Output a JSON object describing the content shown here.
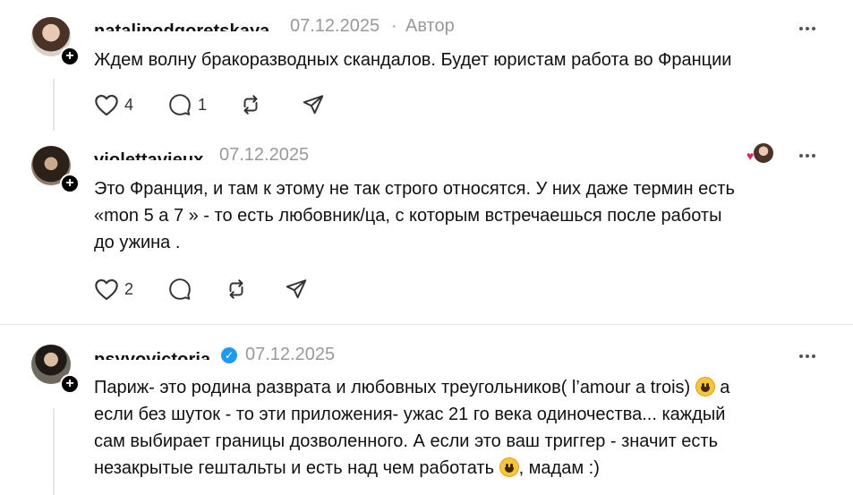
{
  "comments": [
    {
      "username": "natalipodgoretskaya",
      "date": "07.12.2025",
      "separator": "·",
      "author_tag": "Автор",
      "text": "Ждем волну бракоразводных скандалов. Будет юристам работа во Франции",
      "likes": "4",
      "replies": "1"
    },
    {
      "username": "violettavieux",
      "date": "07.12.2025",
      "text_lines": [
        "Это Франция, и там к этому не так строго относятся. У них даже термин есть",
        "«mon 5 a 7 » - то есть любовник/ца, с которым встречаешься после работы",
        "до ужина ."
      ],
      "likes": "2",
      "replies": ""
    },
    {
      "username": "psyvovictoria",
      "date": "07.12.2025",
      "verified": true,
      "text_parts": {
        "l1a": "Париж- это родина разврата и любовных треугольников( l’amour a trois) ",
        "l1b": " а",
        "l2": "если без шуток - то эти приложения- ужас 21 го века одиночества... каждый",
        "l3": "сам выбирает границы дозволенного. А если это ваш триггер - значит есть",
        "l4a": "незакрытые гештальты и есть над чем работать ",
        "l4b": ", мадам :)"
      }
    }
  ],
  "icons": {
    "like": "heart-icon",
    "reply": "comment-icon",
    "repost": "repost-icon",
    "share": "send-icon",
    "more": "more-icon",
    "follow": "plus-icon"
  },
  "colors": {
    "follow_badge": "#000000",
    "verified": "#1d9bf0",
    "muted_text": "#999999",
    "divider": "#e5e5e5"
  }
}
